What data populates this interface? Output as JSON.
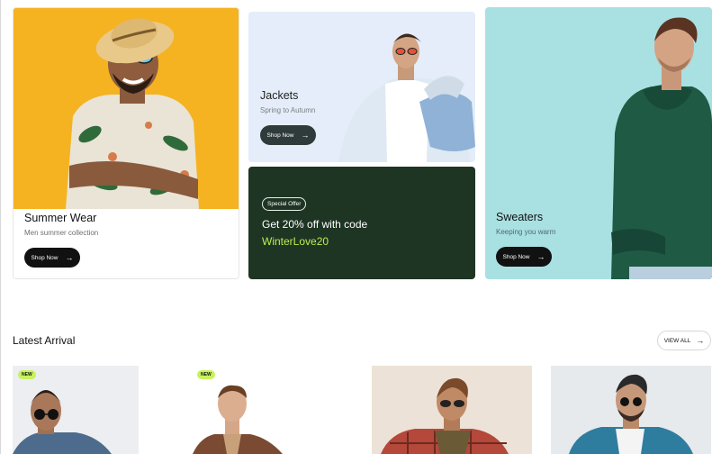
{
  "banners": {
    "summer": {
      "title": "Summer Wear",
      "subtitle": "Men summer collection",
      "button": "Shop Now"
    },
    "jackets": {
      "title": "Jackets",
      "subtitle": "Spring to Autumn",
      "button": "Shop Now"
    },
    "offer": {
      "badge": "Special Offer",
      "text": "Get 20% off with code",
      "code": "WinterLove20"
    },
    "sweaters": {
      "title": "Sweaters",
      "subtitle": "Keeping you warm",
      "button": "Shop Now"
    }
  },
  "latest": {
    "title": "Latest Arrival",
    "view_all": "VIEW ALL",
    "products": [
      {
        "badge": "NEW"
      },
      {
        "badge": "NEW"
      },
      {
        "badge": ""
      },
      {
        "badge": ""
      }
    ]
  },
  "icons": {
    "arrow": "arrow-right-icon"
  },
  "colors": {
    "summer_bg": "#f5b321",
    "jackets_bg": "#e4edf9",
    "offer_bg": "#1f3524",
    "offer_code": "#b8ef4c",
    "sweaters_bg": "#a9e0e2",
    "badge_new": "#c6f25d"
  }
}
